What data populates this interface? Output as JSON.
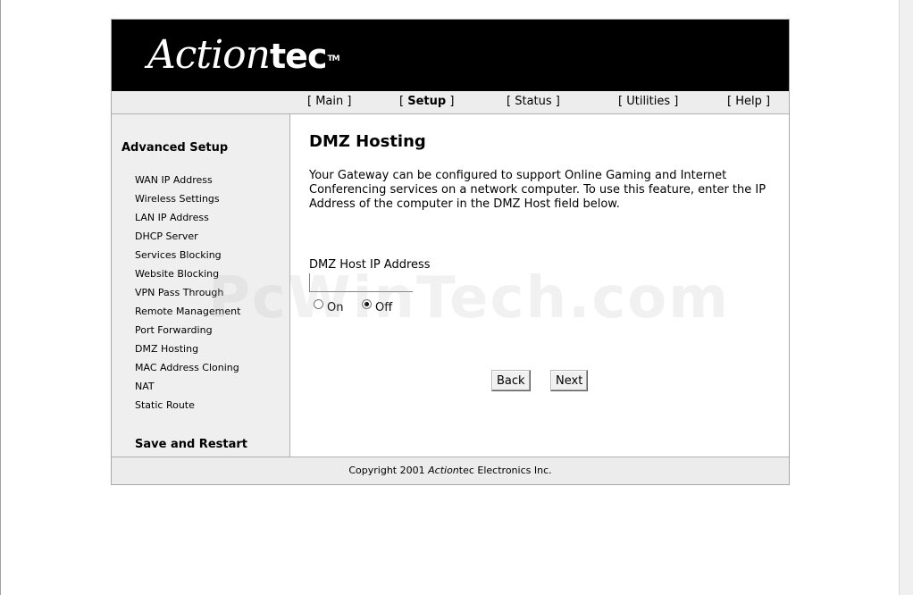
{
  "brand": {
    "logo_part1": "Action",
    "logo_part2": "tec",
    "logo_tm": "TM"
  },
  "nav": {
    "items": [
      {
        "label": "Main",
        "active": false
      },
      {
        "label": "Setup",
        "active": true
      },
      {
        "label": "Status",
        "active": false
      },
      {
        "label": "Utilities",
        "active": false
      },
      {
        "label": "Help",
        "active": false
      }
    ]
  },
  "sidebar": {
    "heading": "Advanced Setup",
    "items": [
      {
        "label": "WAN IP Address"
      },
      {
        "label": "Wireless Settings"
      },
      {
        "label": "LAN IP Address"
      },
      {
        "label": "DHCP Server"
      },
      {
        "label": "Services Blocking"
      },
      {
        "label": "Website Blocking"
      },
      {
        "label": "VPN Pass Through"
      },
      {
        "label": "Remote Management"
      },
      {
        "label": "Port Forwarding"
      },
      {
        "label": "DMZ Hosting"
      },
      {
        "label": "MAC Address Cloning"
      },
      {
        "label": "NAT"
      },
      {
        "label": "Static Route"
      }
    ],
    "save_label": "Save and Restart"
  },
  "main": {
    "title": "DMZ Hosting",
    "description": "Your Gateway can be configured to support Online Gaming and Internet Conferencing services on a network computer. To use this feature, enter the IP Address of the computer in the DMZ Host field below.",
    "field_label": "DMZ Host IP Address",
    "ip_value": "",
    "radio_on_label": "On",
    "radio_off_label": "Off",
    "selected": "Off",
    "back_label": "Back",
    "next_label": "Next"
  },
  "footer": {
    "prefix": "Copyright 2001 ",
    "brand_italic": "Action",
    "brand_rest": "tec Electronics Inc."
  },
  "watermark": "PcWinTech.com",
  "colors": {
    "banner": "#000000",
    "panel": "#efefef",
    "border": "#a8a8a8"
  }
}
